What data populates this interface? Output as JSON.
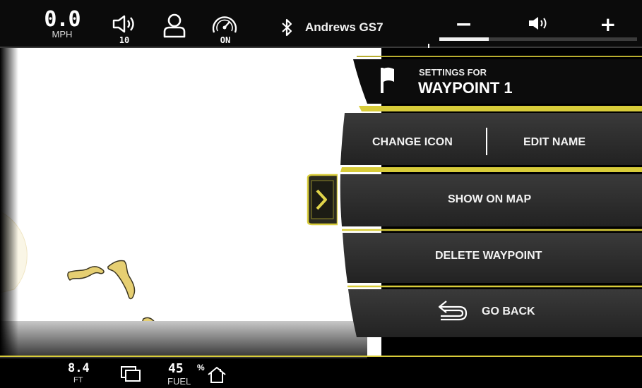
{
  "status_bar": {
    "speed_value": "0.0",
    "speed_unit": "MPH",
    "volume_level": "10",
    "cruise_status": "ON",
    "bluetooth_device": "Andrews GS7",
    "volume_minus": "−",
    "volume_plus": "+",
    "volume_fraction": 0.25
  },
  "waypoint_panel": {
    "header_small": "SETTINGS FOR",
    "header_title": "WAYPOINT 1",
    "change_icon_label": "CHANGE ICON",
    "edit_name_label": "EDIT NAME",
    "show_on_map_label": "SHOW ON MAP",
    "delete_label": "DELETE WAYPOINT",
    "go_back_label": "GO BACK"
  },
  "bottom_bar": {
    "depth_value": "8.4",
    "depth_unit": "FT",
    "fuel_value": "45",
    "fuel_percent_sign": "%",
    "fuel_unit": "FUEL"
  },
  "colors": {
    "accent_yellow": "#d8cc3a",
    "land_fill": "#e6cf72",
    "panel_gray": "#2e2e2e",
    "background": "#000000"
  },
  "icons": [
    "speaker-icon",
    "user-icon",
    "speedometer-icon",
    "bluetooth-icon",
    "flag-icon",
    "chevron-right-icon",
    "back-arrow-icon",
    "windows-icon",
    "home-icon"
  ]
}
